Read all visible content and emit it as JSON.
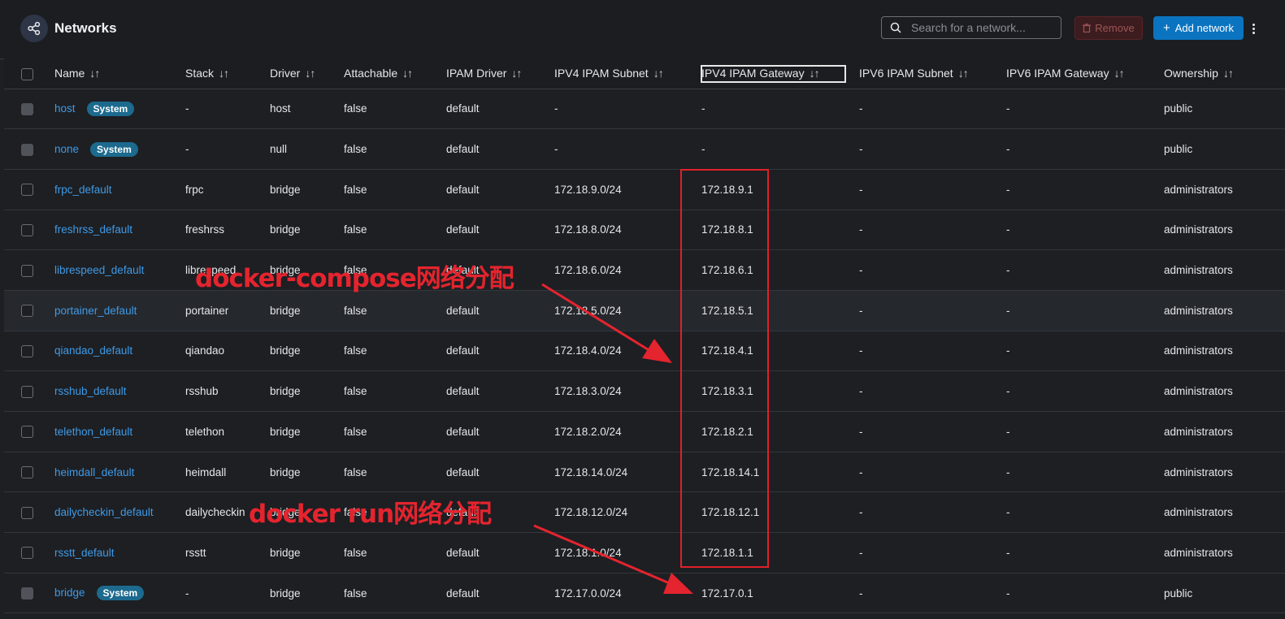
{
  "header": {
    "title": "Networks",
    "search_placeholder": "Search for a network...",
    "remove_label": "Remove",
    "add_label": "Add network"
  },
  "columns": [
    "Name",
    "Stack",
    "Driver",
    "Attachable",
    "IPAM Driver",
    "IPV4 IPAM Subnet",
    "IPV4 IPAM Gateway",
    "IPV6 IPAM Subnet",
    "IPV6 IPAM Gateway",
    "Ownership"
  ],
  "rows": [
    {
      "name": "host",
      "system": true,
      "badge": "System",
      "stack": "-",
      "driver": "host",
      "attachable": "false",
      "ipam_driver": "default",
      "ipv4_subnet": "-",
      "ipv4_gateway": "-",
      "ipv6_subnet": "-",
      "ipv6_gateway": "-",
      "ownership": "public"
    },
    {
      "name": "none",
      "system": true,
      "badge": "System",
      "stack": "-",
      "driver": "null",
      "attachable": "false",
      "ipam_driver": "default",
      "ipv4_subnet": "-",
      "ipv4_gateway": "-",
      "ipv6_subnet": "-",
      "ipv6_gateway": "-",
      "ownership": "public"
    },
    {
      "name": "frpc_default",
      "system": false,
      "stack": "frpc",
      "driver": "bridge",
      "attachable": "false",
      "ipam_driver": "default",
      "ipv4_subnet": "172.18.9.0/24",
      "ipv4_gateway": "172.18.9.1",
      "ipv6_subnet": "-",
      "ipv6_gateway": "-",
      "ownership": "administrators"
    },
    {
      "name": "freshrss_default",
      "system": false,
      "stack": "freshrss",
      "driver": "bridge",
      "attachable": "false",
      "ipam_driver": "default",
      "ipv4_subnet": "172.18.8.0/24",
      "ipv4_gateway": "172.18.8.1",
      "ipv6_subnet": "-",
      "ipv6_gateway": "-",
      "ownership": "administrators"
    },
    {
      "name": "librespeed_default",
      "system": false,
      "stack": "librespeed",
      "driver": "bridge",
      "attachable": "false",
      "ipam_driver": "default",
      "ipv4_subnet": "172.18.6.0/24",
      "ipv4_gateway": "172.18.6.1",
      "ipv6_subnet": "-",
      "ipv6_gateway": "-",
      "ownership": "administrators"
    },
    {
      "name": "portainer_default",
      "system": false,
      "stack": "portainer",
      "driver": "bridge",
      "attachable": "false",
      "ipam_driver": "default",
      "ipv4_subnet": "172.18.5.0/24",
      "ipv4_gateway": "172.18.5.1",
      "ipv6_subnet": "-",
      "ipv6_gateway": "-",
      "ownership": "administrators",
      "highlight": true
    },
    {
      "name": "qiandao_default",
      "system": false,
      "stack": "qiandao",
      "driver": "bridge",
      "attachable": "false",
      "ipam_driver": "default",
      "ipv4_subnet": "172.18.4.0/24",
      "ipv4_gateway": "172.18.4.1",
      "ipv6_subnet": "-",
      "ipv6_gateway": "-",
      "ownership": "administrators"
    },
    {
      "name": "rsshub_default",
      "system": false,
      "stack": "rsshub",
      "driver": "bridge",
      "attachable": "false",
      "ipam_driver": "default",
      "ipv4_subnet": "172.18.3.0/24",
      "ipv4_gateway": "172.18.3.1",
      "ipv6_subnet": "-",
      "ipv6_gateway": "-",
      "ownership": "administrators"
    },
    {
      "name": "telethon_default",
      "system": false,
      "stack": "telethon",
      "driver": "bridge",
      "attachable": "false",
      "ipam_driver": "default",
      "ipv4_subnet": "172.18.2.0/24",
      "ipv4_gateway": "172.18.2.1",
      "ipv6_subnet": "-",
      "ipv6_gateway": "-",
      "ownership": "administrators"
    },
    {
      "name": "heimdall_default",
      "system": false,
      "stack": "heimdall",
      "driver": "bridge",
      "attachable": "false",
      "ipam_driver": "default",
      "ipv4_subnet": "172.18.14.0/24",
      "ipv4_gateway": "172.18.14.1",
      "ipv6_subnet": "-",
      "ipv6_gateway": "-",
      "ownership": "administrators"
    },
    {
      "name": "dailycheckin_default",
      "system": false,
      "stack": "dailycheckin",
      "driver": "bridge",
      "attachable": "false",
      "ipam_driver": "default",
      "ipv4_subnet": "172.18.12.0/24",
      "ipv4_gateway": "172.18.12.1",
      "ipv6_subnet": "-",
      "ipv6_gateway": "-",
      "ownership": "administrators"
    },
    {
      "name": "rsstt_default",
      "system": false,
      "stack": "rsstt",
      "driver": "bridge",
      "attachable": "false",
      "ipam_driver": "default",
      "ipv4_subnet": "172.18.1.0/24",
      "ipv4_gateway": "172.18.1.1",
      "ipv6_subnet": "-",
      "ipv6_gateway": "-",
      "ownership": "administrators"
    },
    {
      "name": "bridge",
      "system": true,
      "badge": "System",
      "stack": "-",
      "driver": "bridge",
      "attachable": "false",
      "ipam_driver": "default",
      "ipv4_subnet": "172.17.0.0/24",
      "ipv4_gateway": "172.17.0.1",
      "ipv6_subnet": "-",
      "ipv6_gateway": "-",
      "ownership": "public"
    }
  ],
  "annotations": {
    "compose_label": "docker-compose网络分配",
    "run_label": "docker run网络分配",
    "color": "#e4242e"
  }
}
